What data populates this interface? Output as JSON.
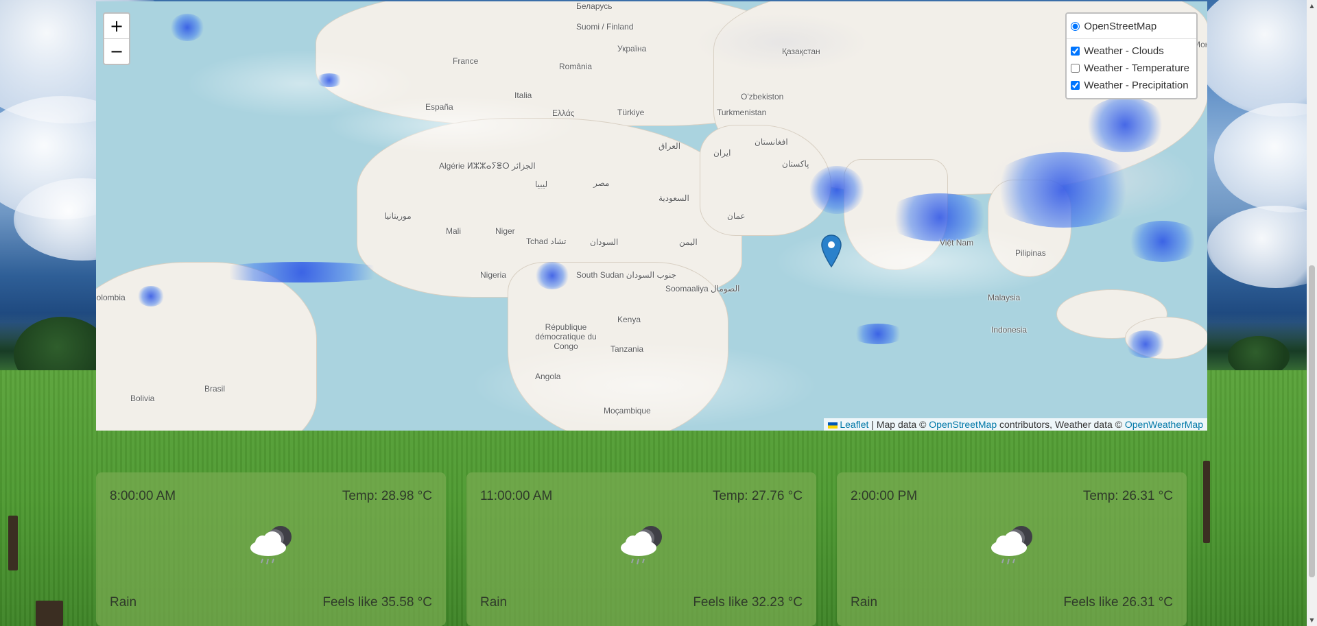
{
  "map": {
    "zoom_in_label": "+",
    "zoom_out_label": "−",
    "base_layers": [
      {
        "label": "OpenStreetMap",
        "selected": true
      }
    ],
    "overlays": [
      {
        "label": "Weather - Clouds",
        "checked": true
      },
      {
        "label": "Weather - Temperature",
        "checked": false
      },
      {
        "label": "Weather - Precipitation",
        "checked": true
      }
    ],
    "attribution": {
      "leaflet": "Leaflet",
      "sep": "| Map data ©",
      "osm": "OpenStreetMap",
      "contrib": "contributors, Weather data ©",
      "owm": "OpenWeatherMap"
    },
    "labels": [
      "Беларусь",
      "Suomi / Finland",
      "France",
      "Україна",
      "România",
      "Қазақстан",
      "Монгол улс",
      "España",
      "Italia",
      "Ελλάς",
      "Türkiye",
      "O'zbekiston",
      "Turkmenistan",
      "Algérie ⵍⵣⵣⴰⵢⴻⵔ الجزائر",
      "ليبيا",
      "مصر",
      "العراق",
      "ایران",
      "افغانستان",
      "پاکستان",
      "السعودية",
      "موريتانيا",
      "Mali",
      "Niger",
      "Tchad تشاد",
      "السودان",
      "اليمن",
      "عمان",
      "Nigeria",
      "South Sudan جنوب السودان",
      "Soomaaliya الصومال",
      "Việt Nam",
      "Pilipinas",
      "République démocratique du Congo",
      "Kenya",
      "Malaysia",
      "Indonesia",
      "Tanzania",
      "Angola",
      "Bolivia",
      "Brasil",
      "Moçambique",
      "Colombia"
    ]
  },
  "forecast": [
    {
      "time": "8:00:00 AM",
      "temp": "Temp: 28.98 °C",
      "desc": "Rain",
      "feels": "Feels like 35.58 °C",
      "icon": "rain-cloud-night-icon"
    },
    {
      "time": "11:00:00 AM",
      "temp": "Temp: 27.76 °C",
      "desc": "Rain",
      "feels": "Feels like 32.23 °C",
      "icon": "rain-cloud-night-icon"
    },
    {
      "time": "2:00:00 PM",
      "temp": "Temp: 26.31 °C",
      "desc": "Rain",
      "feels": "Feels like 26.31 °C",
      "icon": "rain-cloud-night-icon"
    }
  ],
  "colors": {
    "water": "#aad3df",
    "land": "#f2efe9",
    "link": "#0078a8",
    "marker": "#2a81cb",
    "card": "#78aa50"
  }
}
